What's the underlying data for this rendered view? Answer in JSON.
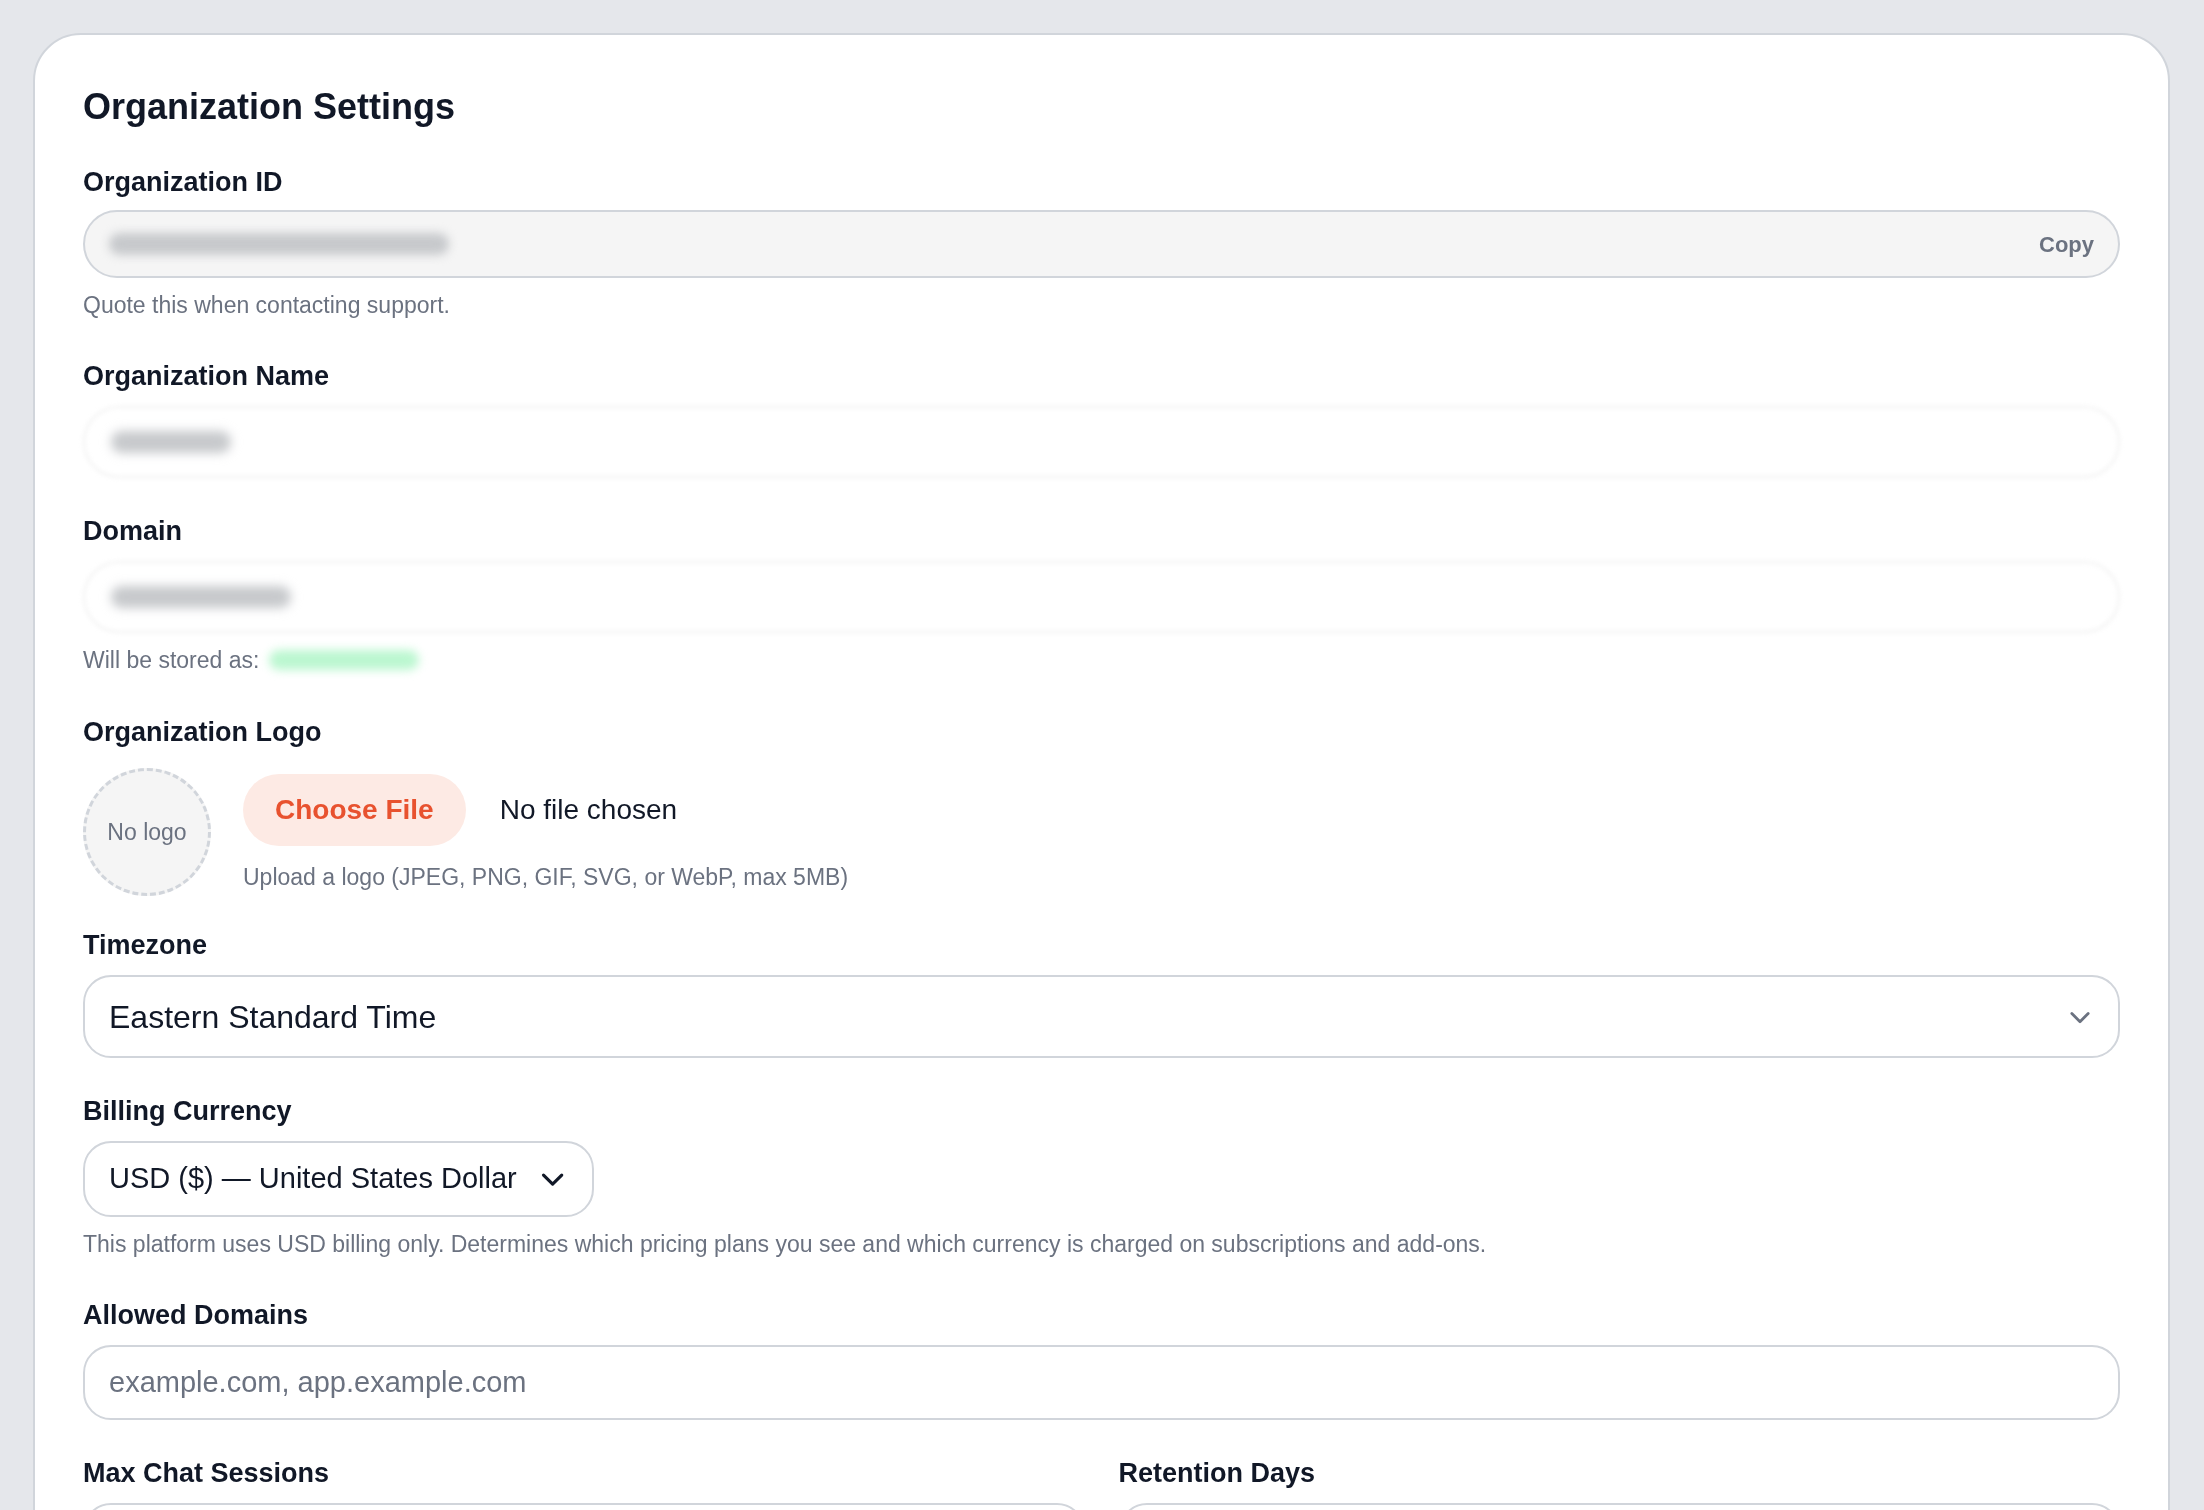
{
  "title": "Organization Settings",
  "organization_id": {
    "label": "Organization ID",
    "copy_button": "Copy",
    "hint": "Quote this when contacting support."
  },
  "organization_name": {
    "label": "Organization Name"
  },
  "domain": {
    "label": "Domain",
    "hint": "Will be stored as:"
  },
  "logo": {
    "label": "Organization Logo",
    "preview": "No logo",
    "button": "Choose File",
    "file_status": "No file chosen",
    "hint": "Upload a logo (JPEG, PNG, GIF, SVG, or WebP, max 5MB)"
  },
  "timezone": {
    "label": "Timezone",
    "value": "Eastern Standard Time"
  },
  "billing_currency": {
    "label": "Billing Currency",
    "value": "USD ($) — United States Dollar",
    "hint": "This platform uses USD billing only. Determines which pricing plans you see and which currency is charged on subscriptions and add-ons."
  },
  "allowed_domains": {
    "label": "Allowed Domains",
    "placeholder": "example.com, app.example.com"
  },
  "bottom_fields": [
    {
      "label": "Max Chat Sessions"
    },
    {
      "label": "Retention Days"
    }
  ]
}
